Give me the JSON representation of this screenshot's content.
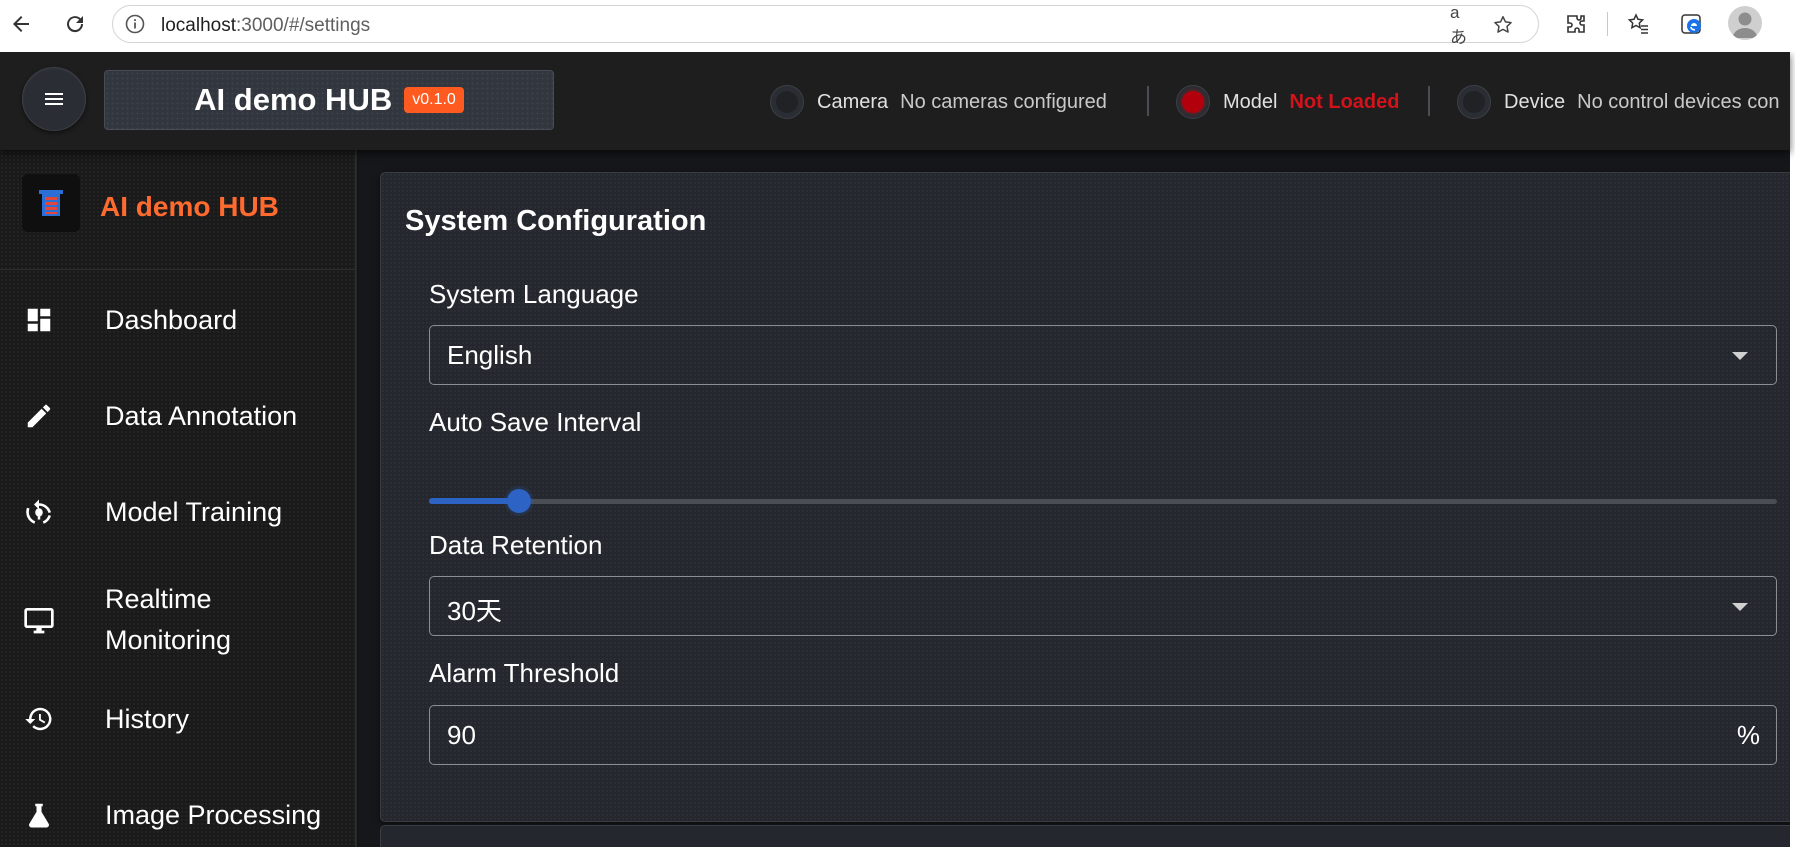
{
  "browser": {
    "url_host": "localhost",
    "url_path": ":3000/#/settings"
  },
  "header": {
    "app_title": "AI demo HUB",
    "version": "v0.1.0",
    "status": [
      {
        "label": "Camera",
        "value": "No cameras configured",
        "state": "off"
      },
      {
        "label": "Model",
        "value": "Not Loaded",
        "state": "error"
      },
      {
        "label": "Device",
        "value": "No control devices con",
        "state": "off"
      }
    ]
  },
  "sidebar": {
    "brand_title": "AI demo HUB",
    "items": [
      {
        "label": "Dashboard",
        "icon": "dashboard-icon"
      },
      {
        "label": "Data Annotation",
        "icon": "pencil-icon"
      },
      {
        "label": "Model Training",
        "icon": "training-icon"
      },
      {
        "label": "Realtime Monitoring",
        "label_line1": "Realtime",
        "label_line2": "Monitoring",
        "icon": "monitor-icon"
      },
      {
        "label": "History",
        "icon": "history-icon"
      },
      {
        "label": "Image Processing",
        "icon": "flask-icon"
      }
    ]
  },
  "settings": {
    "card_title": "System Configuration",
    "language": {
      "label": "System Language",
      "value": "English"
    },
    "auto_save": {
      "label": "Auto Save Interval",
      "slider_fraction": 0.067
    },
    "retention": {
      "label": "Data Retention",
      "value": "30天"
    },
    "alarm": {
      "label": "Alarm Threshold",
      "value": "90",
      "unit": "%"
    }
  },
  "colors": {
    "accent_orange": "#ff6a2f",
    "badge_orange": "#ff5a1f",
    "error_red": "#d3121c",
    "slider_blue": "#2c63c5"
  }
}
